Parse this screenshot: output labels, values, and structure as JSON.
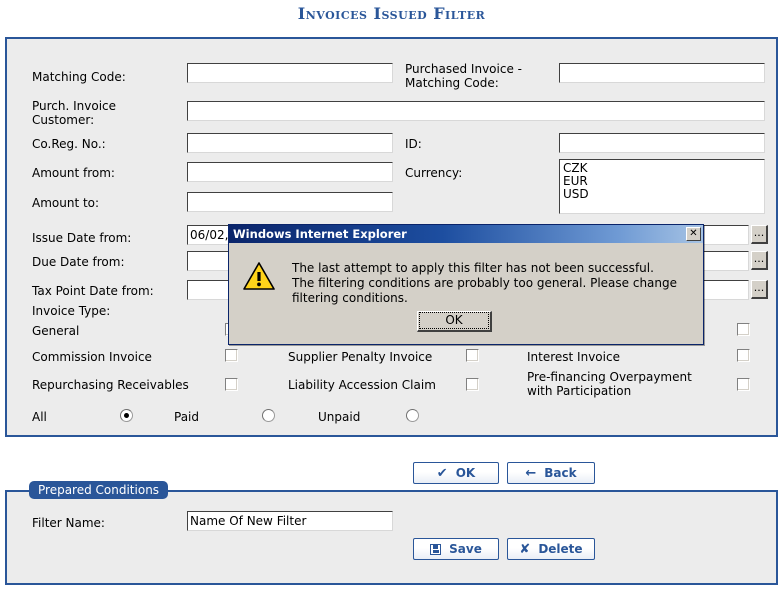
{
  "page": {
    "title": "Invoices Issued Filter"
  },
  "filter_form": {
    "labels": {
      "matching_code": "Matching Code:",
      "purchased_invoice_matching_code": "Purchased Invoice -\nMatching Code:",
      "purch_invoice_customer": "Purch. Invoice\nCustomer:",
      "co_reg_no": "Co.Reg. No.:",
      "id": "ID:",
      "amount_from": "Amount from:",
      "currency": "Currency:",
      "amount_to": "Amount to:",
      "issue_date_from": "Issue Date from:",
      "due_date_from": "Due Date from:",
      "tax_point_date_from": "Tax Point Date from:",
      "invoice_type": "Invoice Type:"
    },
    "values": {
      "matching_code": "",
      "purchased_invoice_matching_code": "",
      "purch_invoice_customer": "",
      "co_reg_no": "",
      "id": "",
      "amount_from": "",
      "amount_to": "",
      "issue_date_from": "06/02,",
      "due_date_from": "",
      "tax_point_date_from": ""
    },
    "currency_options": [
      "CZK",
      "EUR",
      "USD"
    ],
    "browse_button_label": "...",
    "invoice_types": [
      {
        "label": "General",
        "checked": false
      },
      {
        "label": "Commission Invoice",
        "checked": false
      },
      {
        "label": "Supplier Penalty Invoice",
        "checked": false
      },
      {
        "label": "Interest Invoice",
        "checked": false
      },
      {
        "label": "Repurchasing Receivables",
        "checked": false
      },
      {
        "label": "Liability Accession Claim",
        "checked": false
      },
      {
        "label": "Pre-financing Overpayment\nwith Participation",
        "checked": false
      }
    ],
    "payment_status": {
      "options": [
        {
          "label": "All",
          "checked": true
        },
        {
          "label": "Paid",
          "checked": false
        },
        {
          "label": "Unpaid",
          "checked": false
        }
      ]
    }
  },
  "actions": {
    "ok": "OK",
    "back": "Back",
    "save": "Save",
    "delete": "Delete"
  },
  "icons": {
    "ok": "✔",
    "back": "←",
    "delete": "✘",
    "close": "✕"
  },
  "prepared_conditions": {
    "legend": "Prepared Conditions",
    "filter_name_label": "Filter Name:",
    "filter_name_value": "Name Of New Filter"
  },
  "dialog": {
    "title": "Windows Internet Explorer",
    "message_line1": "The last attempt to apply this filter has not been successful.",
    "message_line2": "The filtering conditions are probably too general. Please change filtering conditions.",
    "ok_label": "OK"
  },
  "colors": {
    "accent": "#2a5699",
    "panel_bg": "#ececec",
    "dialog_bg": "#d4d0c8",
    "warning": "#ffd31a"
  }
}
